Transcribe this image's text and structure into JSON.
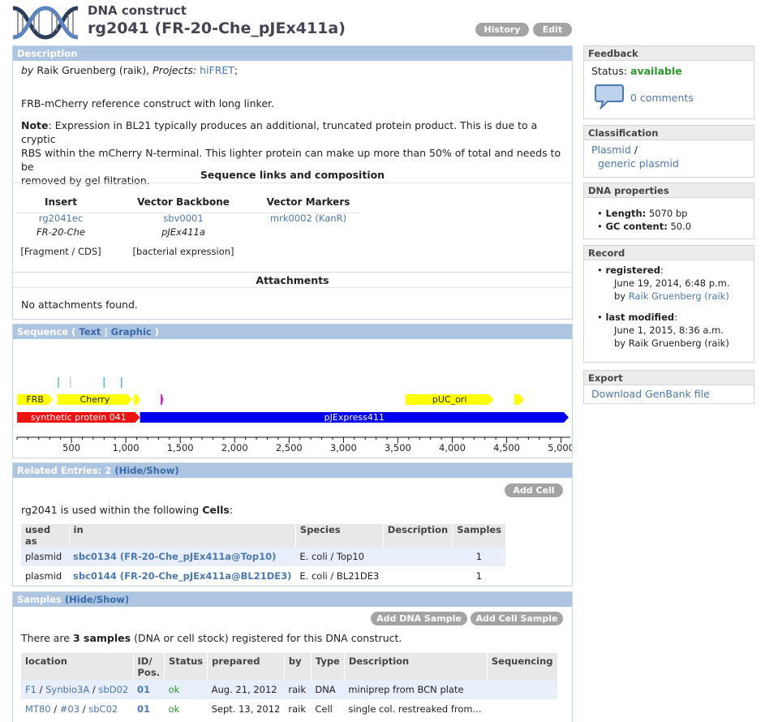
{
  "header": {
    "type_label": "DNA construct",
    "title": "rg2041 (FR-20-Che_pJEx411a)",
    "history_label": "History",
    "edit_label": "Edit"
  },
  "description": {
    "heading": "Description",
    "by_prefix": "by",
    "author": "Raik Gruenberg (raik),",
    "projects_label": "Projects:",
    "project": "hiFRET",
    "project_suffix": ";",
    "summary": "FRB-mCherry reference construct with long linker.",
    "note_label": "Note",
    "note_lines": [
      ": Expression in BL21 typically produces an additional, truncated protein product. This is due to a cryptic",
      "RBS within the mCherry N-terminal. This lighter protein can make up more than 50% of total and needs to be",
      "removed by gel filtration."
    ],
    "composition_title": "Sequence links and composition",
    "columns": [
      {
        "header": "Insert",
        "link": "rg2041ec",
        "name": "FR-20-Che",
        "category": "[Fragment / CDS]"
      },
      {
        "header": "Vector Backbone",
        "link": "sbv0001",
        "name": "pJEx411a",
        "category": "[bacterial expression]"
      },
      {
        "header": "Vector Markers",
        "link": "mrk0002 (KanR)",
        "name": "",
        "category": ""
      }
    ],
    "attachments_title": "Attachments",
    "attachments_text": "No attachments found."
  },
  "sequence": {
    "heading": "Sequence (",
    "text_link": "Text",
    "divider": "|",
    "graphic_link": "Graphic",
    "close": ")",
    "features": [
      {
        "label": "FRB",
        "start": 1,
        "end": 330,
        "color": "#ffff00",
        "row": "feature"
      },
      {
        "label": "Cherry",
        "start": 370,
        "end": 1060,
        "color": "#ffff00",
        "row": "feature"
      },
      {
        "label": "",
        "start": 1075,
        "end": 1130,
        "color": "#ffff00",
        "row": "feature"
      },
      {
        "label": "",
        "start": 1320,
        "end": 1345,
        "color": "#dd22dd",
        "row": "feature"
      },
      {
        "label": "pUC_ori",
        "start": 3570,
        "end": 4380,
        "color": "#ffff00",
        "row": "feature"
      },
      {
        "label": "",
        "start": 4570,
        "end": 4660,
        "color": "#ffff00",
        "row": "feature"
      },
      {
        "label": "synthetic protein 041",
        "start": 1,
        "end": 1130,
        "color": "#ee1111",
        "row": "main"
      },
      {
        "label": "pJExpress411",
        "start": 1130,
        "end": 5070,
        "color": "#0000ee",
        "row": "main"
      }
    ],
    "sites": [
      {
        "pos": 380,
        "color": "#55cc88"
      },
      {
        "pos": 490,
        "color": "#cccccc"
      },
      {
        "pos": 800,
        "color": "#55bbcc"
      },
      {
        "pos": 960,
        "color": "#55bbcc"
      }
    ],
    "ticks": [
      "500",
      "1,000",
      "1,500",
      "2,000",
      "2,500",
      "3,000",
      "3,500",
      "4,000",
      "4,500",
      "5,000"
    ],
    "length": 5070
  },
  "related": {
    "heading": "Related Entries: 2",
    "toggle": "(Hide/Show)",
    "add_cell": "Add Cell",
    "intro": "rg2041 is used within the following",
    "intro_bold": "Cells",
    "intro_end": ":",
    "columns": [
      "used as",
      "in",
      "Species",
      "Description",
      "Samples"
    ],
    "rows": [
      {
        "used_as": "plasmid",
        "in": "sbc0134 (FR-20-Che_pJEx411a@Top10)",
        "species": "E. coli / Top10",
        "description": "",
        "samples": "1"
      },
      {
        "used_as": "plasmid",
        "in": "sbc0144 (FR-20-Che_pJEx411a@BL21DE3)",
        "species": "E. coli / BL21DE3",
        "description": "",
        "samples": "1"
      }
    ]
  },
  "samples": {
    "heading": "Samples",
    "toggle": "(Hide/Show)",
    "add_dna": "Add DNA Sample",
    "add_cell": "Add Cell Sample",
    "intro_a": "There are",
    "intro_count": "3 samples",
    "intro_b": "(DNA or cell stock) registered for this DNA construct.",
    "columns": [
      "location",
      "ID/\nPos.",
      "Status",
      "prepared",
      "by",
      "Type",
      "Description",
      "Sequencing"
    ],
    "rows": [
      {
        "loc1": "F1",
        "loc2": "Synbio3A",
        "loc3": "sbD02",
        "id": "01",
        "status": "ok",
        "prepared": "Aug. 21, 2012",
        "by": "raik",
        "type": "DNA",
        "description": "miniprep from BCN plate",
        "sequencing": ""
      },
      {
        "loc1": "MT80",
        "loc2": "#03",
        "loc3": "sbC02",
        "id": "01",
        "status": "ok",
        "prepared": "Sept. 13, 2012",
        "by": "raik",
        "type": "Cell",
        "description": "single col. restreaked from...",
        "sequencing": ""
      }
    ]
  },
  "sidebar": {
    "feedback": {
      "title": "Feedback",
      "status_label": "Status:",
      "status": "available",
      "comments": "0 comments"
    },
    "classification": {
      "title": "Classification",
      "item1": "Plasmid",
      "sep": "/",
      "item2": "generic plasmid"
    },
    "dna": {
      "title": "DNA properties",
      "length_label": "Length:",
      "length": "5070 bp",
      "gc_label": "GC content:",
      "gc": "50.0"
    },
    "record": {
      "title": "Record",
      "registered_label": "registered",
      "registered_date": "June 19, 2014, 6:48 p.m.",
      "registered_by": "by",
      "registered_user": "Raik Gruenberg (raik)",
      "modified_label": "last modified",
      "modified_date": "June 1, 2015, 8:36 a.m.",
      "modified_by": "by Raik Gruenberg (raik)"
    },
    "export": {
      "title": "Export",
      "link": "Download GenBank file"
    }
  },
  "colors": {
    "panel_head": "#aec5e2",
    "link": "#4a78b0",
    "status_ok": "#2a9a2a"
  }
}
